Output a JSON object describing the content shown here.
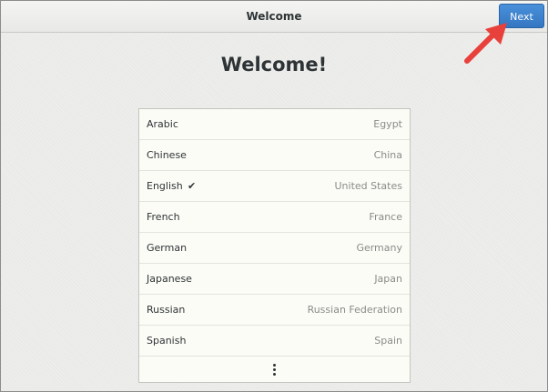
{
  "header": {
    "title": "Welcome",
    "next_label": "Next"
  },
  "main": {
    "title": "Welcome!"
  },
  "languages": [
    {
      "name": "Arabic",
      "country": "Egypt",
      "selected": false
    },
    {
      "name": "Chinese",
      "country": "China",
      "selected": false
    },
    {
      "name": "English",
      "country": "United States",
      "selected": true
    },
    {
      "name": "French",
      "country": "France",
      "selected": false
    },
    {
      "name": "German",
      "country": "Germany",
      "selected": false
    },
    {
      "name": "Japanese",
      "country": "Japan",
      "selected": false
    },
    {
      "name": "Russian",
      "country": "Russian Federation",
      "selected": false
    },
    {
      "name": "Spanish",
      "country": "Spain",
      "selected": false
    }
  ],
  "check_glyph": "✔",
  "icons": {
    "more": "more-vertical-icon",
    "arrow": "annotation-arrow-icon"
  },
  "colors": {
    "accent": "#4a90d9",
    "arrow": "#e8403a"
  }
}
